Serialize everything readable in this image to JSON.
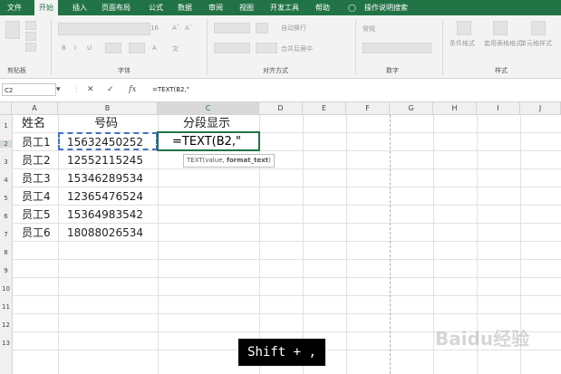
{
  "ribbon_tabs": [
    "文件",
    "开始",
    "插入",
    "页面布局",
    "公式",
    "数据",
    "审阅",
    "视图",
    "开发工具",
    "帮助"
  ],
  "tell_me": "操作说明搜索",
  "ribbon": {
    "groups": [
      "剪贴板",
      "字体",
      "对齐方式",
      "数字",
      "样式"
    ],
    "font_size": "16",
    "wrap_text": "自动换行",
    "merge_center": "合并后居中",
    "number_format": "常规",
    "conditional_format": "条件格式",
    "format_as_table": "套用表格格式",
    "cell_styles": "单元格样式"
  },
  "name_box": "C2",
  "formula_text": "=TEXT(B2,\"",
  "columns": [
    "A",
    "B",
    "C",
    "D",
    "E",
    "F",
    "G",
    "H",
    "I",
    "J"
  ],
  "rows": [
    "1",
    "2",
    "3",
    "4",
    "5",
    "6",
    "7",
    "8",
    "9",
    "10",
    "11",
    "12",
    "13"
  ],
  "headers": {
    "name": "姓名",
    "number": "号码",
    "segment": "分段显示"
  },
  "records": [
    {
      "name": "员工1",
      "number": "15632450252"
    },
    {
      "name": "员工2",
      "number": "12552115245"
    },
    {
      "name": "员工3",
      "number": "15346289534"
    },
    {
      "name": "员工4",
      "number": "12365476524"
    },
    {
      "name": "员工5",
      "number": "15364983542"
    },
    {
      "name": "员工6",
      "number": "18088026534"
    }
  ],
  "edit_cell_text": "=TEXT(B2,\"",
  "tooltip": {
    "func": "TEXT(value, ",
    "bold": "format_text",
    "close": ")"
  },
  "key_hint": "Shift + ,",
  "watermark": "Baidu经验",
  "colors": {
    "ribbon_green": "#217346",
    "select_green": "#217346",
    "ref_blue": "#4472c4"
  }
}
